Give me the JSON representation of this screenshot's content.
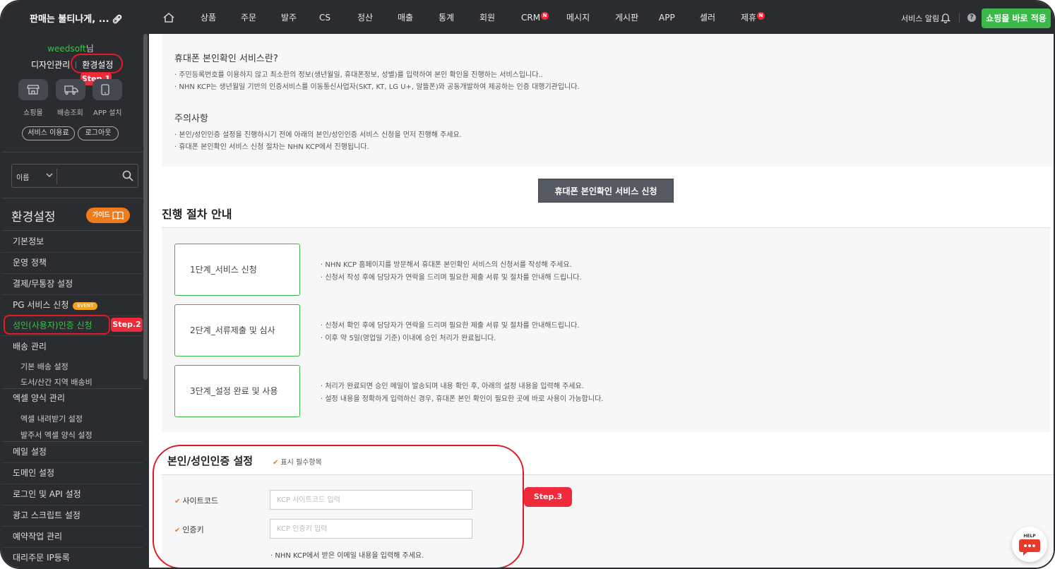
{
  "topbar": {
    "brand": "판매는 불티나게, ...",
    "nav": [
      {
        "label": "상품",
        "n": false
      },
      {
        "label": "주문",
        "n": false
      },
      {
        "label": "발주",
        "n": false
      },
      {
        "label": "CS",
        "n": false
      },
      {
        "label": "정산",
        "n": false
      },
      {
        "label": "매출",
        "n": false
      },
      {
        "label": "통계",
        "n": false
      },
      {
        "label": "회원",
        "n": false
      },
      {
        "label": "CRM",
        "n": true
      },
      {
        "label": "메시지",
        "n": false
      },
      {
        "label": "게시판",
        "n": false
      },
      {
        "label": "APP",
        "n": false
      },
      {
        "label": "셀러",
        "n": false
      },
      {
        "label": "제휴",
        "n": true
      }
    ],
    "badge_letter": "N",
    "service_alarm": "서비스 알림",
    "help": "?",
    "apply_button": "쇼핑몰 바로 적용"
  },
  "sidebar": {
    "user": "weedsoft",
    "user_suffix": "님",
    "link_design": "디자인관리",
    "link_settings": "환경설정",
    "step1": "Step.1",
    "quick": [
      {
        "label": "쇼핑몰",
        "icon": "store-icon"
      },
      {
        "label": "배송조회",
        "icon": "truck-icon"
      },
      {
        "label": "APP 설치",
        "icon": "phone-icon"
      }
    ],
    "pill_service": "서비스 이용료",
    "pill_logout": "로그아웃",
    "search_select": "이름",
    "search_placeholder": "",
    "section_title": "환경설정",
    "guide": "가이드",
    "menu": {
      "basic": "기본정보",
      "policy": "운영 정책",
      "payment": "결제/무통장 설정",
      "pg": "PG 서비스 신청",
      "event": "EVENT",
      "auth": "성인(사용자)인증 신청",
      "step2": "Step.2",
      "delivery": "배송 관리",
      "delivery_basic": "기본 배송 설정",
      "delivery_island": "도서/산간 지역 배송비",
      "excel": "엑셀 양식 관리",
      "excel_download": "엑셀 내려받기 설정",
      "excel_order": "발주서 엑셀 양식 설정",
      "mail": "메일 설정",
      "domain": "도메인 설정",
      "login_api": "로그인 및 API 설정",
      "ad_script": "광고 스크립트 설정",
      "reservation": "예약작업 관리",
      "proxy_ip": "대리주문 IP등록"
    }
  },
  "main": {
    "info_title": "휴대폰 본인확인 서비스란?",
    "info_lines": [
      "· 주민등록번호를 이용하지 않고 최소한의 정보(생년월일, 휴대폰정보, 성별)를 입력하여 본인 확인을 진행하는 서비스입니다..",
      "· NHN KCP는 생년월일 기반의 인증서비스를 이동통신사업자(SKT, KT, LG U+, 알뜰폰)와 공동개발하여 제공하는 인증 대행기관입니다."
    ],
    "caution_title": "주의사항",
    "caution_lines": [
      "· 본인/성인인증 설정을 진행하시기 전에 아래의 본인/성인인증 서비스 신청을 먼저 진행해 주세요.",
      "· 휴대폰 본인확인 서비스 신청 절차는 NHN KCP에서 진행됩니다."
    ],
    "apply_kcp": "휴대폰 본인확인 서비스 신청",
    "process_title": "진행 절차 안내",
    "steps": [
      {
        "label": "1단계_서비스 신청",
        "lines": [
          "· NHN KCP 홈페이지를 방문해서 휴대폰 본인확인 서비스의 신청서를 작성해 주세요.",
          "· 신청서 작성 후에 담당자가 연락을 드리며 필요한 제출 서류 및 절차를 안내해 드립니다."
        ]
      },
      {
        "label": "2단계_서류제출 및 심사",
        "lines": [
          "· 신청서 확인 후에 담당자가 연락을 드리며 필요한 제출 서류 및 절차를 안내해드립니다.",
          "· 이후 약 5일(영업일 기준) 이내에 승인 처리가 완료됩니다."
        ]
      },
      {
        "label": "3단계_설정 완료 및 사용",
        "lines": [
          "· 처리가 완료되면 승인 메일이 발송되며 내용 확인 후, 아래의 설정 내용을 입력해 주세요.",
          "· 설정 내용을 정확하게 입력하신 경우, 휴대폰 본인 확인이 필요한 곳에 바로 사용이 가능합니다."
        ]
      }
    ],
    "auth_title": "본인/성인인증 설정",
    "required_note": "표시 필수항목",
    "site_code_label": "사이트코드",
    "site_code_placeholder": "KCP 사이트코드 입력",
    "auth_key_label": "인증키",
    "auth_key_placeholder": "KCP 인증키 입력",
    "field_note": "· NHN KCP에서 받은 이메일 내용을 입력해 주세요.",
    "step3": "Step.3",
    "help_label": "HELP"
  },
  "colors": {
    "topbar_bg": "#2a2c30",
    "accent_green": "#3cb84a",
    "accent_orange": "#f07a1e",
    "step_red": "#e01b26"
  }
}
